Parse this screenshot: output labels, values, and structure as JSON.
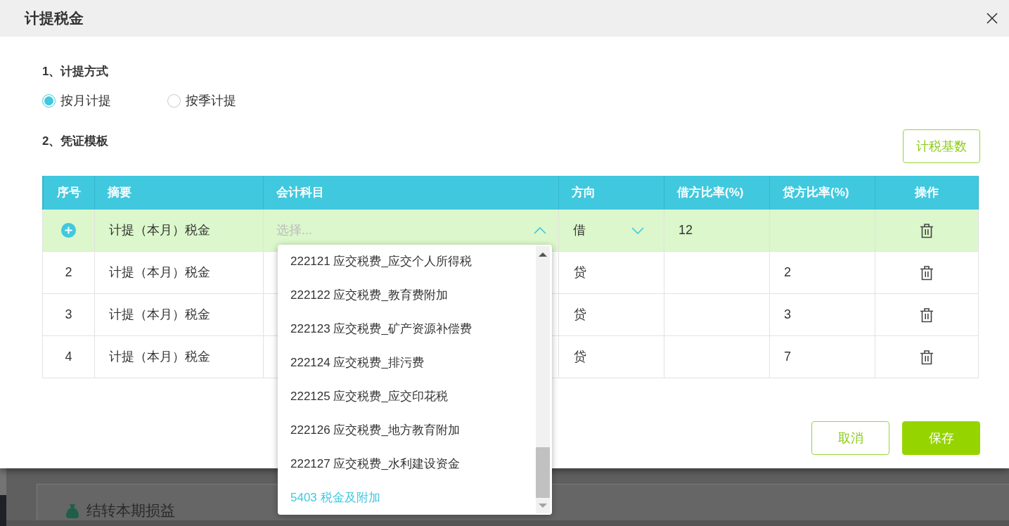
{
  "dialog": {
    "title": "计提税金"
  },
  "method": {
    "heading": "1、计提方式",
    "options": [
      {
        "label": "按月计提",
        "selected": true
      },
      {
        "label": "按季计提",
        "selected": false
      }
    ]
  },
  "template": {
    "heading": "2、凭证模板",
    "tax_base_button": "计税基数",
    "table": {
      "columns": [
        "序号",
        "摘要",
        "会计科目",
        "方向",
        "借方比率(%)",
        "贷方比率(%)",
        "操作"
      ],
      "rows": [
        {
          "kind": "editing",
          "selected": true,
          "summary": "计提（本月）税金",
          "account": {
            "placeholder": "选择...",
            "expanded": true,
            "options": [
              {
                "label": "222121 应交税费_应交个人所得税",
                "selected": false
              },
              {
                "label": "222122 应交税费_教育费附加",
                "selected": false
              },
              {
                "label": "222123 应交税费_矿产资源补偿费",
                "selected": false
              },
              {
                "label": "222124 应交税费_排污费",
                "selected": false
              },
              {
                "label": "222125 应交税费_应交印花税",
                "selected": false
              },
              {
                "label": "222126 应交税费_地方教育附加",
                "selected": false
              },
              {
                "label": "222127 应交税费_水利建设资金",
                "selected": false
              },
              {
                "label": "5403 税金及附加",
                "selected": true
              }
            ]
          },
          "direction": "借",
          "debit_rate": "12"
        },
        {
          "kind": "plain",
          "selected": false,
          "number": "2",
          "summary": "计提（本月）税金",
          "direction": "贷",
          "credit_rate": "2"
        },
        {
          "kind": "plain",
          "selected": false,
          "number": "3",
          "summary": "计提（本月）税金",
          "direction": "贷",
          "credit_rate": "3"
        },
        {
          "kind": "plain",
          "selected": false,
          "number": "4",
          "summary": "计提（本月）税金",
          "direction": "贷",
          "credit_rate": "7"
        }
      ]
    }
  },
  "footer": {
    "buttons": [
      {
        "label": "取消",
        "kind": "secondary"
      },
      {
        "label": "保存",
        "kind": "primary"
      }
    ]
  },
  "background": {
    "item": "结转本期损益"
  }
}
